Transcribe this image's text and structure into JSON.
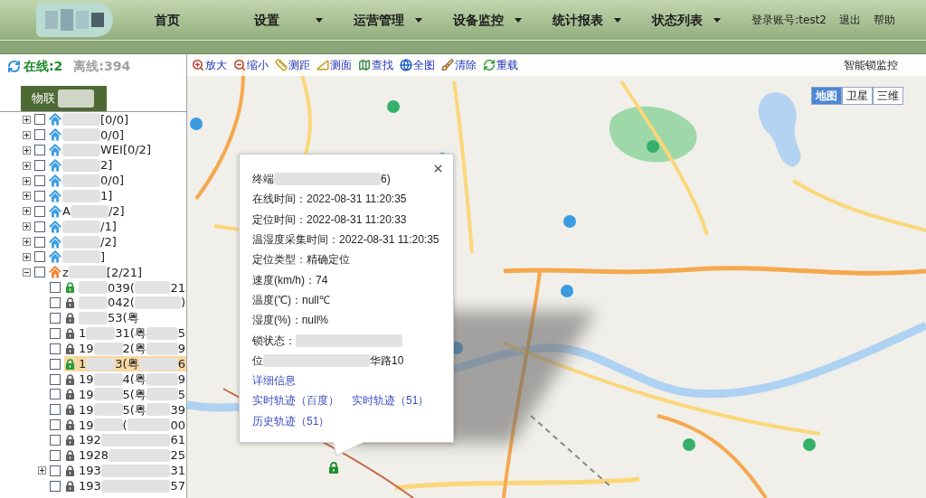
{
  "header": {
    "nav": [
      {
        "label": "首页",
        "has_menu": false
      },
      {
        "label": "设置",
        "has_menu": true
      },
      {
        "label": "运营管理",
        "has_menu": true
      },
      {
        "label": "设备监控",
        "has_menu": true
      },
      {
        "label": "统计报表",
        "has_menu": true
      },
      {
        "label": "状态列表",
        "has_menu": true
      }
    ],
    "account": "登录账号:test2",
    "links": [
      "退出",
      "帮助"
    ]
  },
  "sidebar": {
    "online": "在线:2",
    "offline": "离线:394",
    "tab": {
      "label": "物联",
      "selected": true
    },
    "tree": [
      {
        "parts": [
          {
            "kind": "blur"
          },
          {
            "kind": "text",
            "text": "[0/0]"
          }
        ],
        "expanded": false,
        "checked": false,
        "online": false,
        "selected": false
      },
      {
        "parts": [
          {
            "kind": "blur"
          },
          {
            "kind": "text",
            "text": "0/0]"
          }
        ],
        "expanded": false,
        "checked": false,
        "online": false,
        "selected": false
      },
      {
        "parts": [
          {
            "kind": "blur"
          },
          {
            "kind": "text",
            "text": "WEI[0/2]"
          }
        ],
        "expanded": false,
        "checked": false,
        "online": false,
        "selected": false
      },
      {
        "parts": [
          {
            "kind": "blur"
          },
          {
            "kind": "text",
            "text": "2]"
          }
        ],
        "expanded": false,
        "checked": false,
        "online": false,
        "selected": false
      },
      {
        "parts": [
          {
            "kind": "blur"
          },
          {
            "kind": "text",
            "text": "0/0]"
          }
        ],
        "expanded": false,
        "checked": false,
        "online": false,
        "selected": false
      },
      {
        "parts": [
          {
            "kind": "blur"
          },
          {
            "kind": "text",
            "text": "1]"
          }
        ],
        "expanded": false,
        "checked": false,
        "online": false,
        "selected": false
      },
      {
        "parts": [
          {
            "kind": "text",
            "text": "A"
          },
          {
            "kind": "blur"
          },
          {
            "kind": "text",
            "text": "/2]"
          }
        ],
        "expanded": false,
        "checked": false,
        "online": false,
        "selected": false
      },
      {
        "parts": [
          {
            "kind": "blur"
          },
          {
            "kind": "text",
            "text": "/1]"
          }
        ],
        "expanded": false,
        "checked": false,
        "online": false,
        "selected": false
      },
      {
        "parts": [
          {
            "kind": "blur"
          },
          {
            "kind": "text",
            "text": "/2]"
          }
        ],
        "expanded": false,
        "checked": false,
        "online": false,
        "selected": false
      },
      {
        "parts": [
          {
            "kind": "blur"
          },
          {
            "kind": "text",
            "text": "]"
          }
        ],
        "expanded": false,
        "checked": false,
        "online": false,
        "selected": false
      },
      {
        "parts": [
          {
            "kind": "text",
            "text": "z"
          },
          {
            "kind": "blur"
          },
          {
            "kind": "text",
            "text": "[2/21]"
          }
        ],
        "expanded": true,
        "checked": false,
        "online": true,
        "selected": false,
        "children": [
          {
            "parts": [
              {
                "kind": "blur"
              },
              {
                "kind": "text",
                "text": "039("
              }
            ],
            "end": "21",
            "checked": false,
            "online": true,
            "selected": false
          },
          {
            "parts": [
              {
                "kind": "blur"
              },
              {
                "kind": "text",
                "text": "042("
              }
            ],
            "end": ")",
            "checked": false,
            "online": false,
            "selected": false
          },
          {
            "parts": [
              {
                "kind": "blur"
              },
              {
                "kind": "text",
                "text": "53(粤"
              }
            ],
            "checked": false,
            "online": false,
            "selected": false
          },
          {
            "parts": [
              {
                "kind": "text",
                "text": "1"
              },
              {
                "kind": "blur"
              },
              {
                "kind": "text",
                "text": "31(粤"
              }
            ],
            "end": "5",
            "checked": false,
            "online": false,
            "selected": false
          },
          {
            "parts": [
              {
                "kind": "text",
                "text": "19"
              },
              {
                "kind": "blur"
              },
              {
                "kind": "text",
                "text": "2(粤"
              }
            ],
            "end": "9",
            "checked": false,
            "online": false,
            "selected": false
          },
          {
            "parts": [
              {
                "kind": "text",
                "text": "1"
              },
              {
                "kind": "blur"
              },
              {
                "kind": "text",
                "text": "3(粤"
              }
            ],
            "end": "6",
            "checked": false,
            "online": true,
            "selected": true
          },
          {
            "parts": [
              {
                "kind": "text",
                "text": "19"
              },
              {
                "kind": "blur"
              },
              {
                "kind": "text",
                "text": "4(粤"
              }
            ],
            "end": "9",
            "checked": false,
            "online": false,
            "selected": false
          },
          {
            "parts": [
              {
                "kind": "text",
                "text": "19"
              },
              {
                "kind": "blur"
              },
              {
                "kind": "text",
                "text": "5(粤"
              }
            ],
            "end": "5",
            "checked": false,
            "online": false,
            "selected": false
          },
          {
            "parts": [
              {
                "kind": "text",
                "text": "19"
              },
              {
                "kind": "blur"
              },
              {
                "kind": "text",
                "text": "5(粤"
              }
            ],
            "end": "39",
            "checked": false,
            "online": false,
            "selected": false
          },
          {
            "parts": [
              {
                "kind": "text",
                "text": "19"
              },
              {
                "kind": "blur"
              },
              {
                "kind": "text",
                "text": "("
              }
            ],
            "end": "00",
            "checked": false,
            "online": false,
            "selected": false
          },
          {
            "parts": [
              {
                "kind": "text",
                "text": "192"
              }
            ],
            "end": "61",
            "checked": false,
            "online": false,
            "selected": false
          },
          {
            "parts": [
              {
                "kind": "text",
                "text": "1928"
              }
            ],
            "end": "25",
            "checked": false,
            "online": false,
            "selected": false
          },
          {
            "parts": [
              {
                "kind": "text",
                "text": "193"
              }
            ],
            "end": "31",
            "expanded": false,
            "checked": false,
            "online": false,
            "selected": false
          },
          {
            "parts": [
              {
                "kind": "text",
                "text": "193"
              }
            ],
            "end": "57",
            "checked": false,
            "online": false,
            "selected": false
          }
        ]
      }
    ]
  },
  "map": {
    "toolbar": [
      "放大",
      "缩小",
      "测距",
      "测面",
      "查找",
      "全图",
      "清除",
      "重载"
    ],
    "title": "智能锁监控",
    "map_types": [
      {
        "label": "地图",
        "selected": true
      },
      {
        "label": "卫星",
        "selected": false
      },
      {
        "label": "三维",
        "selected": false
      }
    ],
    "popup": {
      "rows": [
        {
          "parts": [
            {
              "kind": "text",
              "text": "终端"
            },
            {
              "kind": "blur"
            },
            {
              "kind": "text",
              "text": "6)"
            }
          ]
        },
        {
          "parts": [
            {
              "kind": "text",
              "text": "在线时间：2022-08-31 11:20:35"
            }
          ]
        },
        {
          "parts": [
            {
              "kind": "text",
              "text": "定位时间：2022-08-31 11:20:33"
            }
          ]
        },
        {
          "parts": [
            {
              "kind": "text",
              "text": "温湿度采集时间：2022-08-31 11:20:35"
            }
          ]
        },
        {
          "parts": [
            {
              "kind": "text",
              "text": "定位类型：精确定位"
            }
          ]
        },
        {
          "parts": [
            {
              "kind": "text",
              "text": "速度(km/h)：74"
            }
          ]
        },
        {
          "parts": [
            {
              "kind": "text",
              "text": "温度(℃)：null℃"
            }
          ]
        },
        {
          "parts": [
            {
              "kind": "text",
              "text": "湿度(%)：null%"
            }
          ]
        },
        {
          "parts": [
            {
              "kind": "text",
              "text": "锁状态："
            },
            {
              "kind": "blur"
            }
          ]
        },
        {
          "parts": [
            {
              "kind": "text",
              "text": "位"
            },
            {
              "kind": "blur"
            },
            {
              "kind": "text",
              "text": "华路10"
            }
          ]
        }
      ],
      "link_rows": [
        [
          "详细信息"
        ],
        [
          "实时轨迹（百度）",
          "实时轨迹（51）"
        ],
        [
          "历史轨迹（51）"
        ]
      ]
    },
    "marker": {
      "online": true
    }
  }
}
